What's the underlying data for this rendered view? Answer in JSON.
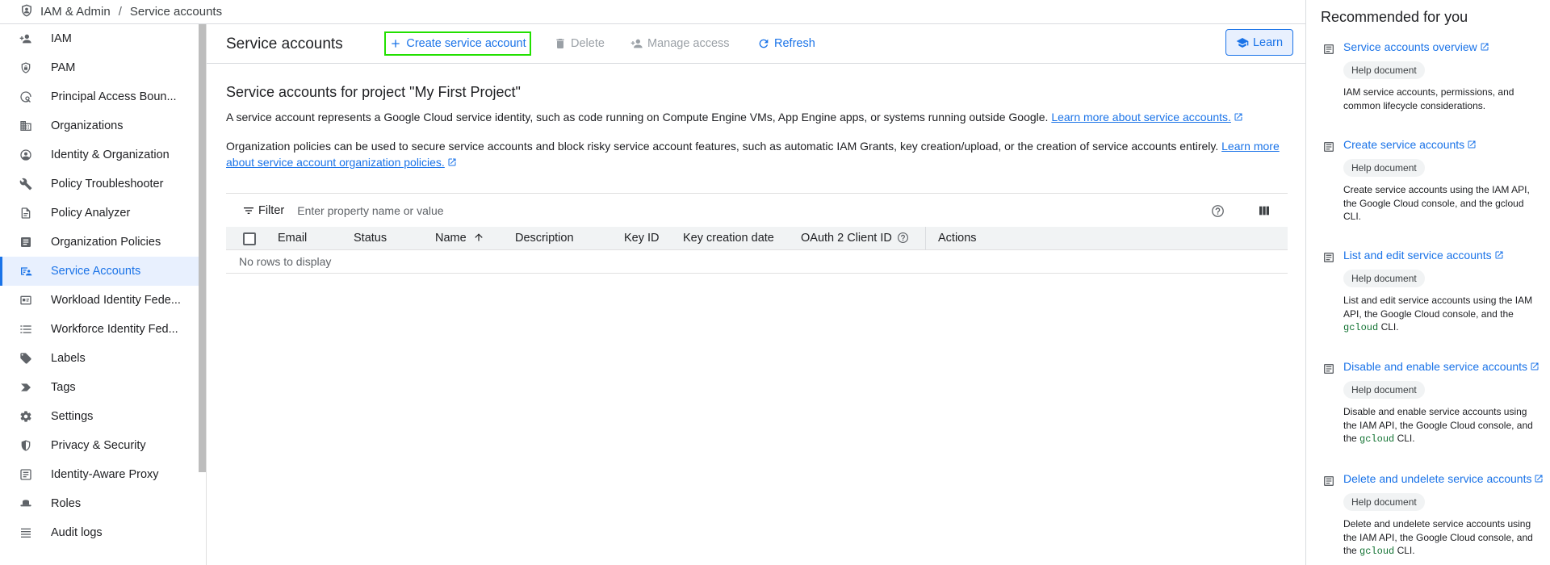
{
  "breadcrumb": {
    "root": "IAM & Admin",
    "separator": "/",
    "current": "Service accounts"
  },
  "sidebar": {
    "items": [
      {
        "label": "IAM",
        "icon": "person-add-icon"
      },
      {
        "label": "PAM",
        "icon": "shield-lock-icon"
      },
      {
        "label": "Principal Access Boun...",
        "icon": "policy-search-icon"
      },
      {
        "label": "Organizations",
        "icon": "domain-icon"
      },
      {
        "label": "Identity & Organization",
        "icon": "account-circle-icon"
      },
      {
        "label": "Policy Troubleshooter",
        "icon": "wrench-icon"
      },
      {
        "label": "Policy Analyzer",
        "icon": "analyzer-doc-icon"
      },
      {
        "label": "Organization Policies",
        "icon": "article-icon"
      },
      {
        "label": "Service Accounts",
        "icon": "service-account-icon",
        "active": true
      },
      {
        "label": "Workload Identity Fede...",
        "icon": "id-card-icon"
      },
      {
        "label": "Workforce Identity Fed...",
        "icon": "list-icon"
      },
      {
        "label": "Labels",
        "icon": "label-tag-icon"
      },
      {
        "label": "Tags",
        "icon": "chevron-tag-icon"
      },
      {
        "label": "Settings",
        "icon": "gear-icon"
      },
      {
        "label": "Privacy & Security",
        "icon": "shield-icon"
      },
      {
        "label": "Identity-Aware Proxy",
        "icon": "proxy-icon"
      },
      {
        "label": "Roles",
        "icon": "hat-icon"
      },
      {
        "label": "Audit logs",
        "icon": "lines-icon"
      }
    ]
  },
  "header": {
    "title": "Service accounts",
    "create": "Create service account",
    "delete": "Delete",
    "manage": "Manage access",
    "refresh": "Refresh",
    "learn": "Learn"
  },
  "main": {
    "section_title": "Service accounts for project \"My First Project\"",
    "para1": "A service account represents a Google Cloud service identity, such as code running on Compute Engine VMs, App Engine apps, or systems running outside Google.",
    "para1_link": "Learn more about service accounts.",
    "para2": "Organization policies can be used to secure service accounts and block risky service account features, such as automatic IAM Grants, key creation/upload, or the creation of service accounts entirely.",
    "para2_link": "Learn more about service account organization policies."
  },
  "table": {
    "filter_label": "Filter",
    "filter_placeholder": "Enter property name or value",
    "columns": [
      "Email",
      "Status",
      "Name",
      "Description",
      "Key ID",
      "Key creation date",
      "OAuth 2 Client ID",
      "Actions"
    ],
    "sorted_column": "Name",
    "empty_message": "No rows to display"
  },
  "right_panel": {
    "title": "Recommended for you",
    "items": [
      {
        "title": "Service accounts overview",
        "chip": "Help document",
        "desc": "IAM service accounts, permissions, and common lifecycle considerations."
      },
      {
        "title": "Create service accounts",
        "chip": "Help document",
        "desc": "Create service accounts using the IAM API, the Google Cloud console, and the gcloud CLI."
      },
      {
        "title": "List and edit service accounts",
        "chip": "Help document",
        "desc_pre": "List and edit service accounts using the IAM API, the Google Cloud console, and the",
        "code": "gcloud",
        "desc_post": "CLI."
      },
      {
        "title": "Disable and enable service accounts",
        "chip": "Help document",
        "desc_pre": "Disable and enable service accounts using the IAM API, the Google Cloud console, and the",
        "code": "gcloud",
        "desc_post": "CLI."
      },
      {
        "title": "Delete and undelete service accounts",
        "chip": "Help document",
        "desc_pre": "Delete and undelete service accounts using the IAM API, the Google Cloud console, and the",
        "code": "gcloud",
        "desc_post": "CLI."
      }
    ]
  },
  "colors": {
    "accent": "#1a73e8",
    "highlight_border": "#22e000",
    "active_bg": "#e8f0fe",
    "code": "#137333"
  }
}
